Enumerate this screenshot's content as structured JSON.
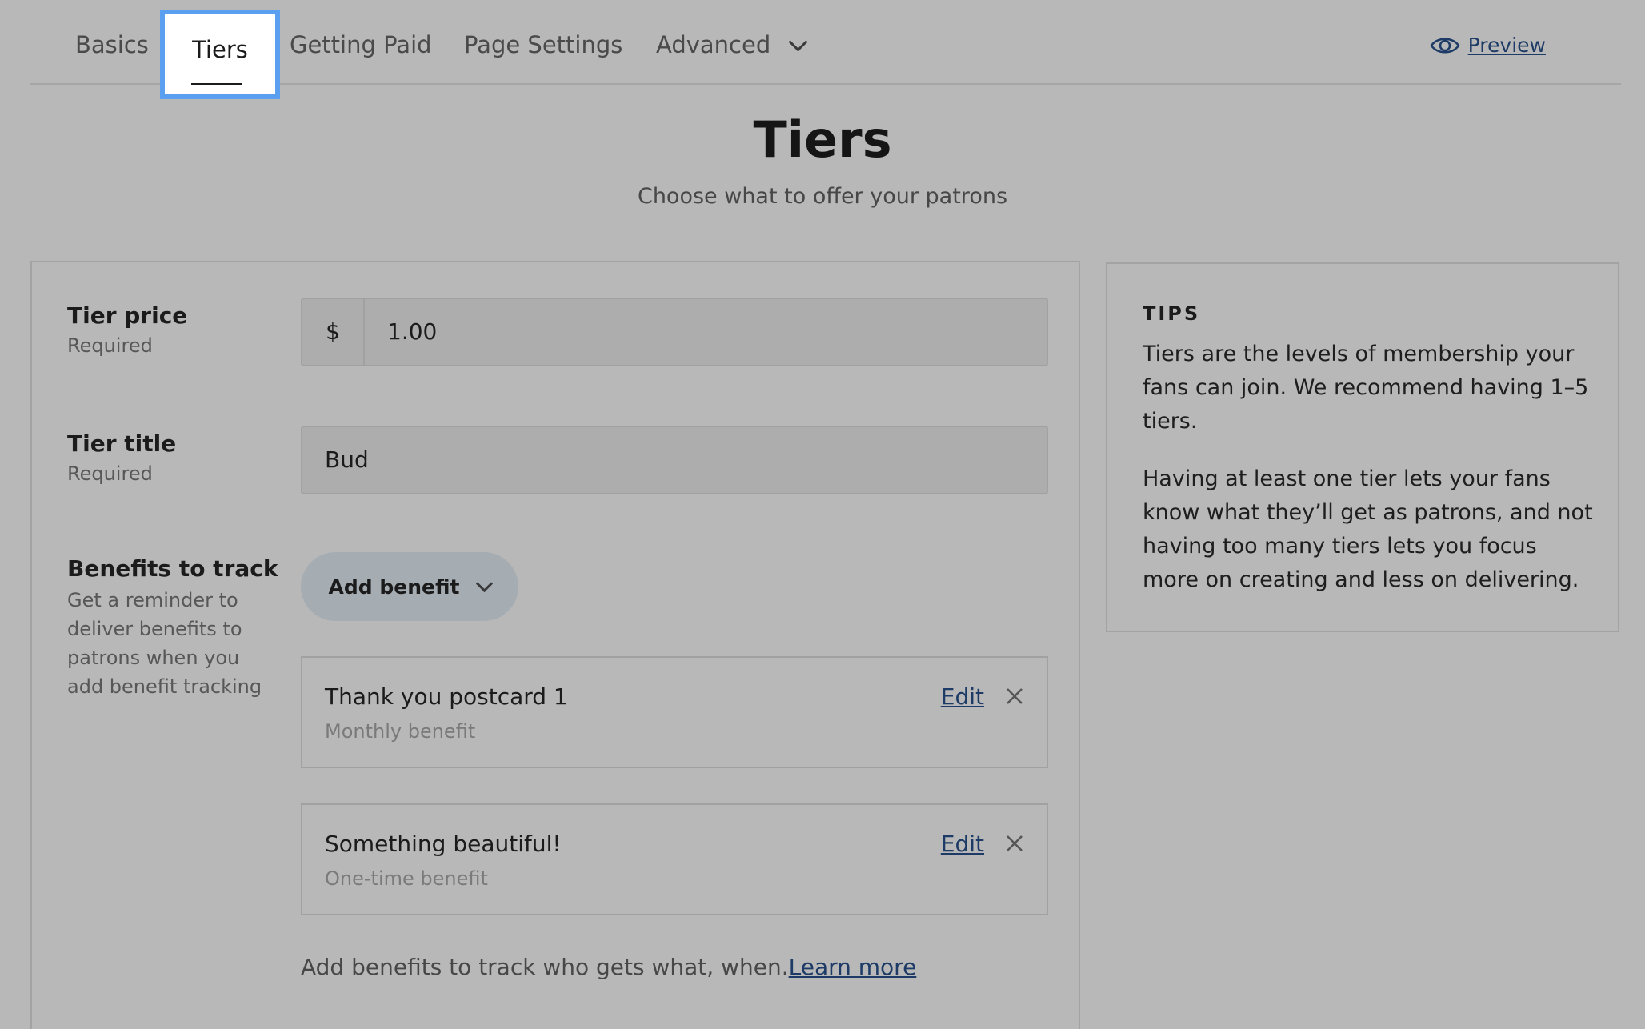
{
  "nav": {
    "tabs": [
      {
        "label": "Basics"
      },
      {
        "label": "Tiers"
      },
      {
        "label": "Getting Paid"
      },
      {
        "label": "Page Settings"
      },
      {
        "label": "Advanced"
      }
    ],
    "active_tab": "Tiers",
    "preview_label": "Preview"
  },
  "header": {
    "title": "Tiers",
    "subtitle": "Choose what to offer your patrons"
  },
  "form": {
    "price": {
      "label": "Tier price",
      "hint": "Required",
      "prefix": "$",
      "value": "1.00"
    },
    "title": {
      "label": "Tier title",
      "hint": "Required",
      "value": "Bud"
    },
    "benefits": {
      "label": "Benefits to track",
      "hint_lines": [
        "Get a reminder to",
        "deliver benefits to",
        "patrons when you",
        "add benefit tracking"
      ],
      "add_button": "Add benefit",
      "items": [
        {
          "name": "Thank you postcard 1",
          "type": "Monthly benefit",
          "edit_label": "Edit"
        },
        {
          "name": "Something beautiful!",
          "type": "One-time benefit",
          "edit_label": "Edit"
        }
      ],
      "footer_text": "Add benefits to track who gets what, when.",
      "learn_more": "Learn more"
    }
  },
  "tips": {
    "title": "TIPS",
    "paragraphs": [
      "Tiers are the levels of membership your fans can join. We recommend having 1–5 tiers.",
      "Having at least one tier lets your fans know what they’ll get as patrons, and not having too many tiers lets you focus more on creating and less on delivering."
    ]
  },
  "colors": {
    "background": "#b8b8b8",
    "focus_ring": "#5b9ff0",
    "link": "#1d3b66"
  }
}
